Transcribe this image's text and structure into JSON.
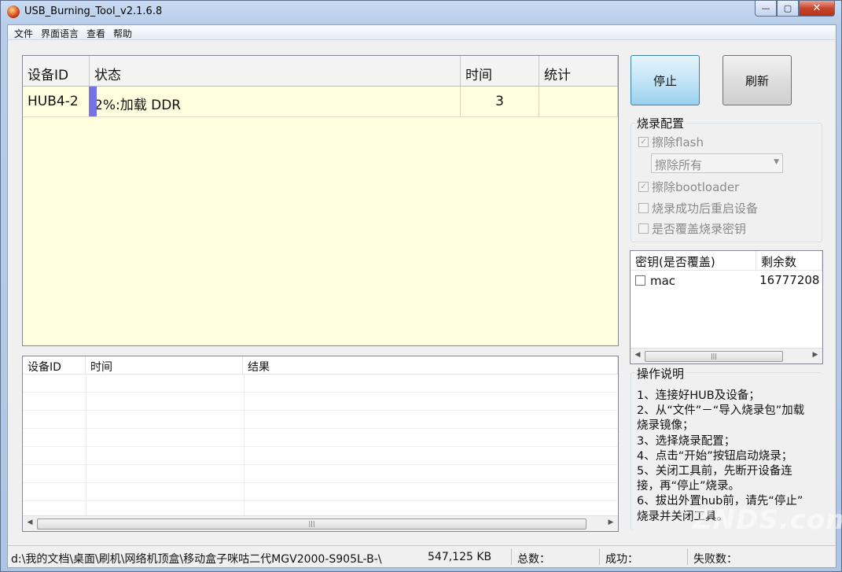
{
  "window": {
    "title": "USB_Burning_Tool_v2.1.6.8",
    "controls": {
      "minimize": "—",
      "maximize": "▢",
      "close": "✕"
    }
  },
  "menu": [
    "文件",
    "界面语言",
    "查看",
    "帮助"
  ],
  "device_table": {
    "headers": [
      "设备ID",
      "状态",
      "时间",
      "统计"
    ],
    "rows": [
      {
        "id": "HUB4-2",
        "status": "2%:加载 DDR",
        "progress": 0.02,
        "time": "3",
        "count": ""
      }
    ]
  },
  "result_table": {
    "headers": [
      "设备ID",
      "时间",
      "结果"
    ],
    "scroll_grip": "|||"
  },
  "buttons": {
    "stop": "停止",
    "refresh": "刷新"
  },
  "burn_config": {
    "title": "烧录配置",
    "erase_flash": {
      "label": "擦除flash",
      "checked": true
    },
    "erase_mode": "擦除所有",
    "erase_bootloader": {
      "label": "擦除bootloader",
      "checked": true
    },
    "reboot_after": {
      "label": "烧录成功后重启设备",
      "checked": false
    },
    "overwrite_key": {
      "label": "是否覆盖烧录密钥",
      "checked": false
    }
  },
  "key_list": {
    "headers": [
      "密钥(是否覆盖)",
      "剩余数"
    ],
    "rows": [
      {
        "name": "mac",
        "remaining": "16777208",
        "checked": false
      }
    ],
    "scroll_grip": "|||"
  },
  "instructions": {
    "title": "操作说明",
    "lines": [
      "1、连接好HUB及设备；",
      "2、从“文件”－“导入烧录包”加载",
      "烧录镜像；",
      "3、选择烧录配置；",
      "4、点击“开始”按钮启动烧录；",
      "5、关闭工具前，先断开设备连",
      "接，再“停止”烧录。",
      "6、拔出外置hub前，请先“停止”",
      "烧录并关闭工具。"
    ]
  },
  "statusbar": {
    "path": "d:\\我的文档\\桌面\\刷机\\网络机顶盒\\移动盒子咪咕二代MGV2000-S905L-B-\\",
    "size": "547,125 KB",
    "total_label": "总数：",
    "success_label": "成功：",
    "fail_label": "失败数："
  },
  "watermark": "ZNDS.com"
}
